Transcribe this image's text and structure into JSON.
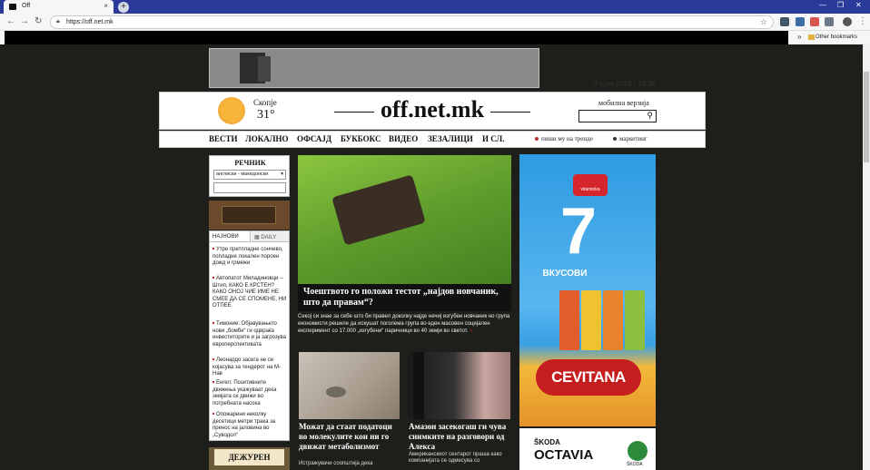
{
  "browser": {
    "tab_title": "Off",
    "tab_close": "×",
    "new_tab": "+",
    "url": "https://off.net.mk",
    "other_bookmarks": "Other bookmarks",
    "window_controls": [
      "—",
      "❐",
      "✕"
    ]
  },
  "site": {
    "date": "7 јуни 2019 / 19:36",
    "weather": {
      "city": "Скопје",
      "temp": "31°"
    },
    "logo": "off.net.mk",
    "mobile_link": "мобилна верзија",
    "nav": [
      "ВЕСТИ",
      "ЛОКАЛНО",
      "ОФСАЈД",
      "БУКБОКС",
      "ВИДЕО",
      "ЗЕЗАЛИЦИ",
      "И СЛ."
    ],
    "nav_secondary": [
      {
        "label": "пиши му на тренде",
        "color": "#c62828"
      },
      {
        "label": "маркетинг",
        "color": "#333333"
      }
    ]
  },
  "sidebar": {
    "dictionary_title": "РЕЧНИК",
    "dictionary_select": "англиски - македонски",
    "tabs": [
      "НАЈНОВИ",
      "DAILY"
    ],
    "news": [
      "Утре претпладне сончево, попладне локален пороен дожд и грмежи",
      "Автопатот Миладиновци – Штип, КАКО Е КРСТЕН? КАКО ОНОЈ ЧИЕ ИМЕ НЕ СМЕЕ ДА СЕ СПОМЕНЕ, НИ ОТПЕЕ",
      "Тимоние: Објавувањето нови „бомби“ ги одвраќа инвеститорите и ја загрозува европерспективата",
      "Леонардо засега не се којасува за тендерот на М-Нав",
      "Енгел: Позитивните движења укажуваат дека земјата се движи во потребната насока",
      "Опожарени неколку десетици метри трака за пренос на јаловина во „Суводол“"
    ],
    "duty_label": "ДЕЖУРЕН"
  },
  "main": {
    "headline": "Чоештвото го положи тестот „најдов новчаник, што да правам“?",
    "summary": "Секој си знае за себе што би правел доколку најде нечиј изгубен новчаник но група економисти решиле да искушат поголема група во еден масовен социјален експеримент со 17.000 „изгубени“ паричници во 40 земји во светот.",
    "more": "»",
    "story2_title": "Можат да стаат податоци во молекулите кои ни го движат метаболизмот",
    "story2_summary": "Истражувачи соопштија дека",
    "story3_title": "Амазон засекогаш ги чува снимките на разговори од Алекса",
    "story3_summary": "Американскиот сентарот праша како компанијата се одмесува со"
  },
  "ads": {
    "brand": "vitaminka",
    "big_number": "7",
    "flavors": "ВКУСОВИ",
    "product": "CEVITANA",
    "car_brand": "ŠKODA",
    "car_model": "OCTAVIA",
    "car_logo_text": "ŠKODA"
  }
}
